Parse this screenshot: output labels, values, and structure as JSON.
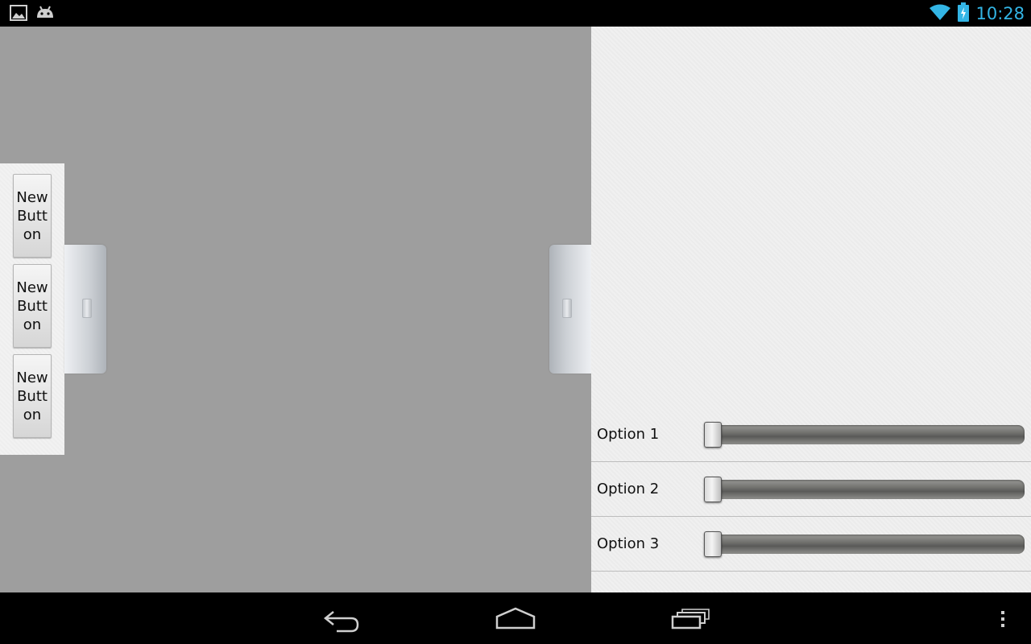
{
  "status_bar": {
    "time": "10:28",
    "icons": [
      "gallery-icon",
      "android-icon",
      "wifi-icon",
      "battery-charging-icon"
    ]
  },
  "left_drawer": {
    "buttons": [
      {
        "label": "New Button"
      },
      {
        "label": "New Button"
      },
      {
        "label": "New Button"
      }
    ]
  },
  "options": [
    {
      "label": "Option 1",
      "value": 0
    },
    {
      "label": "Option 2",
      "value": 0
    },
    {
      "label": "Option 3",
      "value": 0
    }
  ],
  "nav_bar": {
    "icons": [
      "back-icon",
      "home-icon",
      "recent-apps-icon",
      "overflow-menu-icon"
    ]
  },
  "colors": {
    "status_accent": "#33b5e5",
    "main_background": "#9e9e9e",
    "panel_background": "#f0f0f0"
  }
}
